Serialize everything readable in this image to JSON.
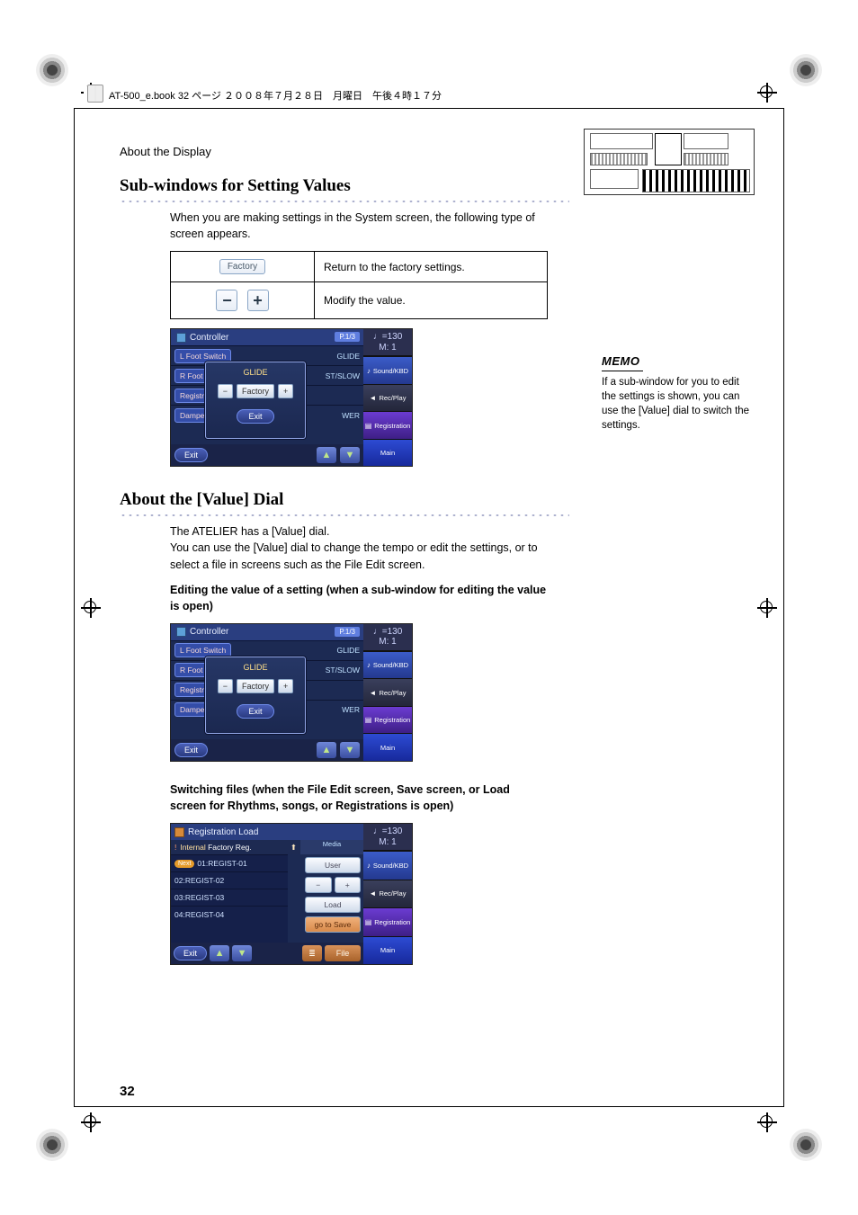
{
  "file_header": "AT-500_e.book 32 ページ ２００８年７月２８日　月曜日　午後４時１７分",
  "running_head": "About the Display",
  "section1": {
    "title": "Sub-windows for Setting Values",
    "intro": "When you are making settings in the System screen, the following type of screen appears.",
    "table": [
      {
        "key_kind": "factory",
        "label": "Factory",
        "desc": "Return to the factory settings."
      },
      {
        "key_kind": "plusminus",
        "desc": "Modify the value."
      }
    ]
  },
  "memo": {
    "heading": "MEMO",
    "body": "If a sub-window for you to edit the settings is shown, you can use the [Value] dial to switch the settings."
  },
  "controller_screen": {
    "title": "Controller",
    "page": "P.1/3",
    "rows": [
      {
        "label": "L Foot Switch",
        "value": "GLIDE"
      },
      {
        "label": "R Foot",
        "value": "ST/SLOW"
      },
      {
        "label": "Registra",
        "value": ""
      },
      {
        "label": "Damper",
        "value": "WER"
      }
    ],
    "popup_value": "GLIDE",
    "popup_factory": "Factory",
    "popup_exit": "Exit",
    "exit": "Exit",
    "tempo_line1": "♩=130",
    "tempo_line2": "M:    1",
    "side": [
      "Sound/KBD",
      "Rec/Play",
      "Registration",
      "Main"
    ]
  },
  "section2": {
    "title": "About the [Value] Dial",
    "p1": "The ATELIER has a [Value] dial.",
    "p2": "You can use the [Value] dial to change the tempo or edit the settings, or to select a file in screens such as the File Edit screen.",
    "sub1": "Editing the value of a setting (when a sub-window for editing the value is open)",
    "sub2": "Switching files (when the File Edit screen, Save screen, or Load screen for Rhythms, songs, or Registrations is open)"
  },
  "reg_load_screen": {
    "title": "Registration Load",
    "internal": "Internal",
    "factory_reg": "Factory Reg.",
    "media_hdr": "Media",
    "user_btn": "User",
    "items": [
      "01:REGIST-01",
      "02:REGIST-02",
      "03:REGIST-03",
      "04:REGIST-04"
    ],
    "next_badge": "Next",
    "minus": "−",
    "plus": "+",
    "load": "Load",
    "go_save": "go to Save",
    "file": "File",
    "exit": "Exit"
  },
  "page_number": "32",
  "glyph": {
    "minus": "−",
    "plus": "+",
    "up": "▲",
    "down": "▼",
    "note": "♪",
    "rec": "◄",
    "bars": "≣",
    "house": "⌂",
    "disk": "▤",
    "home": "⬆",
    "excl": "!"
  }
}
